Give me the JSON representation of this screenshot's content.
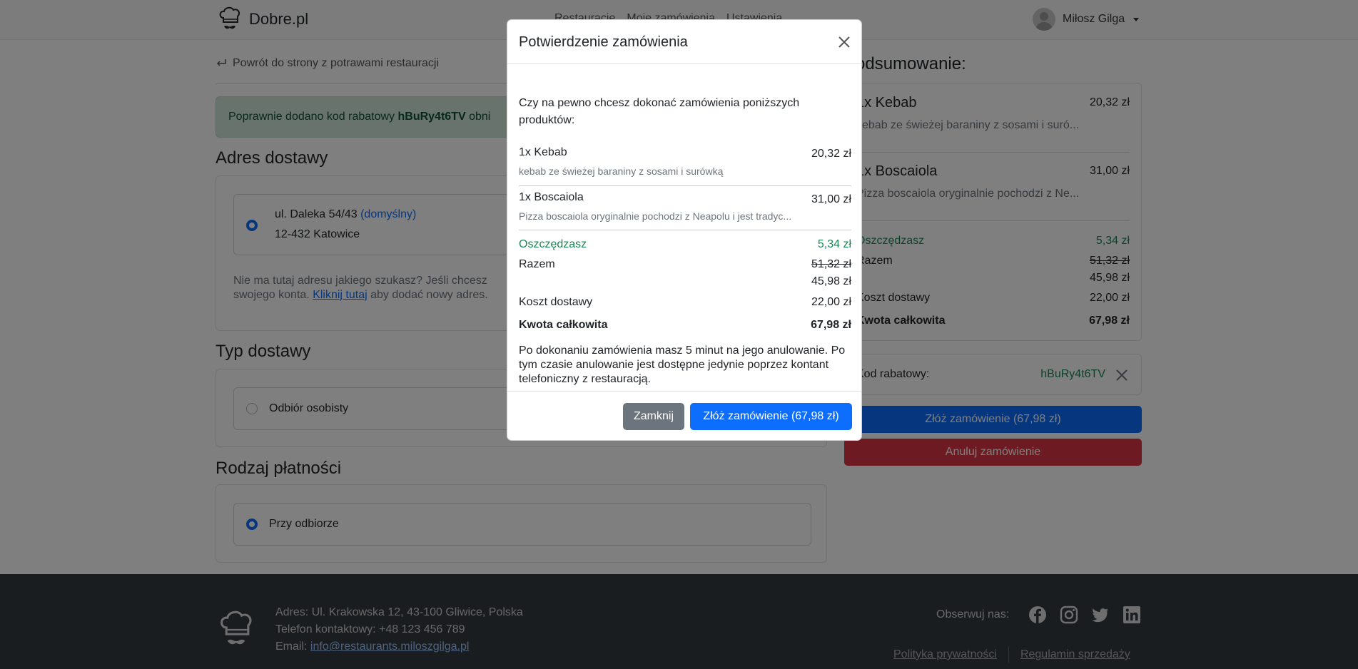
{
  "navbar": {
    "brand": "Dobre.pl",
    "links": [
      "Restauracje",
      "Moje zamówienia",
      "Ustawienia"
    ],
    "user_name": "Miłosz Gilga"
  },
  "page": {
    "back_link": "Powrót do strony z potrawami restauracji",
    "alert_prefix": "Poprawnie dodano kod rabatowy",
    "alert_code": "hBuRy4t6TV",
    "alert_suffix": "obni",
    "address_title": "Adres dostawy",
    "address_line1": "ul. Daleka 54/43",
    "address_default": "(domyślny)",
    "address_line2": "12-432 Katowice",
    "address_help_1": "Nie ma tutaj adresu jakiego szukasz? Jeśli chcesz",
    "address_help_2": "swojego konta.",
    "address_help_link": "Kliknij tutaj",
    "address_help_3": "aby dodać nowy adres.",
    "delivery_title": "Typ dostawy",
    "delivery_option": "Odbiór osobisty",
    "payment_title": "Rodzaj płatności",
    "payment_option": "Przy odbiorze"
  },
  "summary": {
    "title": "Podsumowanie:",
    "items": [
      {
        "name": "1x Kebab",
        "price": "20,32 zł",
        "desc": "kebab ze świeżej baraniny z sosami i suró..."
      },
      {
        "name": "1x Boscaiola",
        "price": "31,00 zł",
        "desc": "Pizza boscaiola oryginalnie pochodzi z Ne..."
      }
    ],
    "savings_label": "Oszczędzasz",
    "savings_value": "5,34 zł",
    "total_label": "Razem",
    "total_old": "51,32 zł",
    "total_new": "45,98 zł",
    "delivery_label": "Koszt dostawy",
    "delivery_value": "22,00 zł",
    "grand_label": "Kwota całkowita",
    "grand_value": "67,98 zł",
    "promo_label": "Kod rabatowy:",
    "promo_code": "hBuRy4t6TV",
    "order_button": "Złóż zamówienie (67,98 zł)",
    "cancel_button": "Anuluj zamówienie"
  },
  "modal": {
    "title": "Potwierdzenie zamówienia",
    "question": "Czy na pewno chcesz dokonać zamówienia poniższych produktów:",
    "items": [
      {
        "name": "1x Kebab",
        "price": "20,32 zł",
        "desc": "kebab ze świeżej baraniny z sosami i surówką"
      },
      {
        "name": "1x Boscaiola",
        "price": "31,00 zł",
        "desc": "Pizza boscaiola oryginalnie pochodzi z Neapolu i jest tradyc..."
      }
    ],
    "savings_label": "Oszczędzasz",
    "savings_value": "5,34 zł",
    "total_label": "Razem",
    "total_old": "51,32 zł",
    "total_new": "45,98 zł",
    "delivery_label": "Koszt dostawy",
    "delivery_value": "22,00 zł",
    "grand_label": "Kwota całkowita",
    "grand_value": "67,98 zł",
    "note": "Po dokonaniu zamówienia masz 5 minut na jego anulowanie. Po tym czasie anulowanie jest dostępne jedynie poprzez kontant telefoniczny z restauracją.",
    "close_button": "Zamknij",
    "confirm_button": "Złóż zamówienie (67,98 zł)"
  },
  "footer": {
    "address": "Adres: Ul. Krakowska 12, 43-100 Gliwice, Polska",
    "phone": "Telefon kontaktowy: +48 123 456 789",
    "email_label": "Email:",
    "email": "info@restaurants.miloszgilga.pl",
    "follow": "Obserwuj nas:",
    "privacy": "Polityka prywatności",
    "terms": "Regulamin sprzedaży"
  }
}
